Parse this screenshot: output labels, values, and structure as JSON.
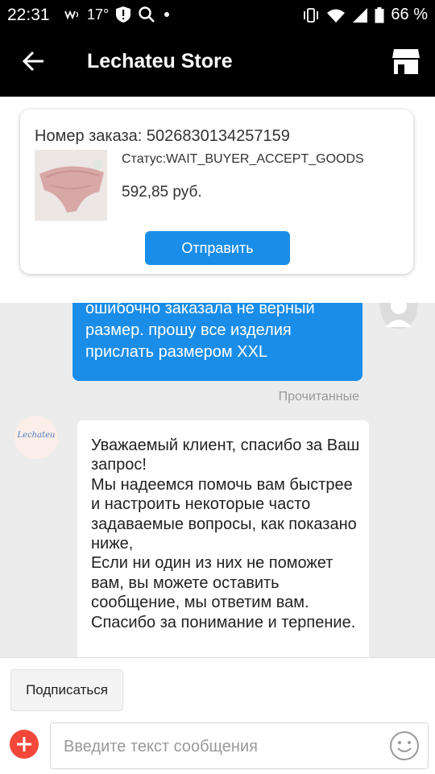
{
  "status_bar": {
    "time": "22:31",
    "temperature": "17°",
    "battery": "66 %",
    "icons": [
      "wifi-calling-icon",
      "alert-icon",
      "search-icon",
      "dot-icon",
      "vibrate-icon",
      "wifi-icon",
      "signal-icon",
      "battery-icon"
    ]
  },
  "header": {
    "title": "Lechateu Store",
    "icons": [
      "back-arrow-icon",
      "store-icon"
    ]
  },
  "order": {
    "number_label": "Номер заказа: 5026830134257159",
    "status": "Статус:WAIT_BUYER_ACCEPT_GOODS",
    "price": "592,85 руб.",
    "send_label": "Отправить"
  },
  "chat": {
    "outgoing_text": "ошибочно заказала не верный размер. прошу все изделия прислать размером XXL",
    "read_status": "Прочитанные",
    "store_avatar_text": "Lechateu",
    "incoming_text": "Уважаемый клиент, спасибо за Ваш запрос!\nМы надеемся помочь вам быстрее и настроить некоторые часто задаваемые вопросы, как показано ниже,\nЕсли ни один из них не поможет вам, вы можете оставить сообщение, мы ответим вам.\nСпасибо за понимание и терпение.",
    "accent_color": "#1a8de8"
  },
  "footer": {
    "subscribe_label": "Подписаться",
    "input_placeholder": "Введите текст сообщения",
    "plus_color": "#f4473a"
  }
}
